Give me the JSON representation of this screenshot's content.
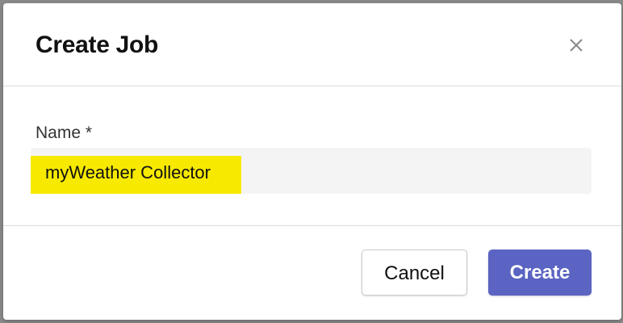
{
  "dialog": {
    "title": "Create Job",
    "close_icon": "close-icon"
  },
  "form": {
    "name_label": "Name *",
    "name_value": "myWeather Collector",
    "highlight_color": "#f7ea00"
  },
  "footer": {
    "cancel_label": "Cancel",
    "create_label": "Create",
    "create_color": "#5b64c2"
  }
}
